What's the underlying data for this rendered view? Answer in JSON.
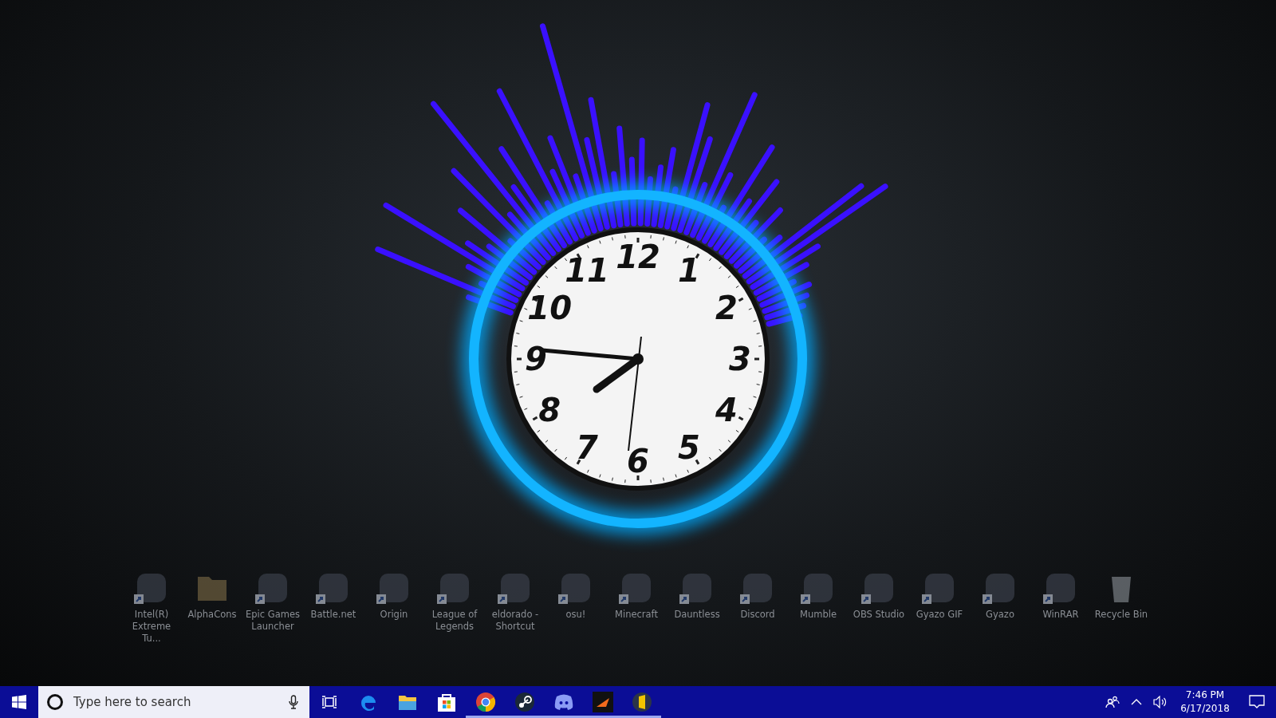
{
  "clock": {
    "numerals": [
      "12",
      "11",
      "1",
      "10",
      "2",
      "9",
      "3",
      "8",
      "4",
      "7",
      "5",
      "6"
    ]
  },
  "desktop_icons": [
    {
      "label": "Intel(R) Extreme Tu...",
      "kind": "app",
      "shortcut": true
    },
    {
      "label": "AlphaCons",
      "kind": "folder",
      "shortcut": false
    },
    {
      "label": "Epic Games Launcher",
      "kind": "app",
      "shortcut": true
    },
    {
      "label": "Battle.net",
      "kind": "app",
      "shortcut": true
    },
    {
      "label": "Origin",
      "kind": "app",
      "shortcut": true
    },
    {
      "label": "League of Legends",
      "kind": "app",
      "shortcut": true
    },
    {
      "label": "eldorado - Shortcut",
      "kind": "app",
      "shortcut": true
    },
    {
      "label": "osu!",
      "kind": "app",
      "shortcut": true
    },
    {
      "label": "Minecraft",
      "kind": "app",
      "shortcut": true
    },
    {
      "label": "Dauntless",
      "kind": "app",
      "shortcut": true
    },
    {
      "label": "Discord",
      "kind": "app",
      "shortcut": true
    },
    {
      "label": "Mumble",
      "kind": "app",
      "shortcut": true
    },
    {
      "label": "OBS Studio",
      "kind": "app",
      "shortcut": true
    },
    {
      "label": "Gyazo GIF",
      "kind": "app",
      "shortcut": true
    },
    {
      "label": "Gyazo",
      "kind": "app",
      "shortcut": true
    },
    {
      "label": "WinRAR",
      "kind": "app",
      "shortcut": true
    },
    {
      "label": "Recycle Bin",
      "kind": "trash",
      "shortcut": false
    }
  ],
  "taskbar": {
    "search": {
      "placeholder": "Type here to search"
    },
    "pinned": [
      {
        "kind": "edge",
        "running": false
      },
      {
        "kind": "explorer",
        "running": false
      },
      {
        "kind": "store",
        "running": false
      },
      {
        "kind": "chrome",
        "running": true
      },
      {
        "kind": "steam",
        "running": true
      },
      {
        "kind": "discord",
        "running": true
      },
      {
        "kind": "app",
        "running": true
      },
      {
        "kind": "yellow",
        "running": true
      }
    ],
    "time": "7:46 PM",
    "date": "6/17/2018"
  }
}
